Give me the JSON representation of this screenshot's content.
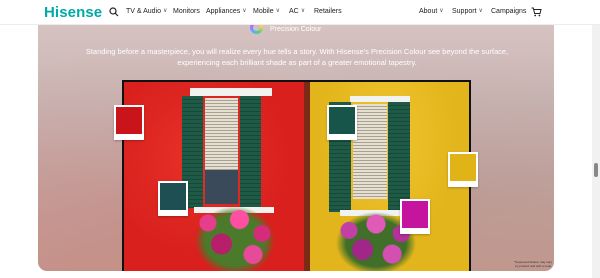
{
  "nav": {
    "logo": "Hisense",
    "items": [
      {
        "label": "TV & Audio",
        "has_dropdown": true
      },
      {
        "label": "Monitors",
        "has_dropdown": false
      },
      {
        "label": "Appliances",
        "has_dropdown": true
      },
      {
        "label": "Mobile",
        "has_dropdown": true
      },
      {
        "label": "AC",
        "has_dropdown": true
      },
      {
        "label": "Retailers",
        "has_dropdown": false
      }
    ],
    "right_items": [
      {
        "label": "About",
        "has_dropdown": true
      },
      {
        "label": "Support",
        "has_dropdown": true
      },
      {
        "label": "Campaigns",
        "has_dropdown": false
      }
    ],
    "icons": {
      "search": "search-icon",
      "cart": "cart-icon"
    }
  },
  "hero": {
    "feature_title": "Precision Colour",
    "description": "Standing before a masterpiece, you will realize every hue tells a story. With Hisense's Precision Colour see beyond the surface, experiencing each brilliant shade as part of a greater emotional tapestry.",
    "disclaimer": "*Supposed feature may vary by product and with a code.",
    "swatches": [
      {
        "name": "red",
        "color": "#c8141a"
      },
      {
        "name": "dark-green",
        "color": "#17544a"
      },
      {
        "name": "teal",
        "color": "#1d4f53"
      },
      {
        "name": "yellow",
        "color": "#e0b417"
      },
      {
        "name": "magenta",
        "color": "#c5159f"
      }
    ]
  },
  "colors": {
    "brand": "#00aaa6",
    "hero_bg": "#c9b5b3"
  }
}
